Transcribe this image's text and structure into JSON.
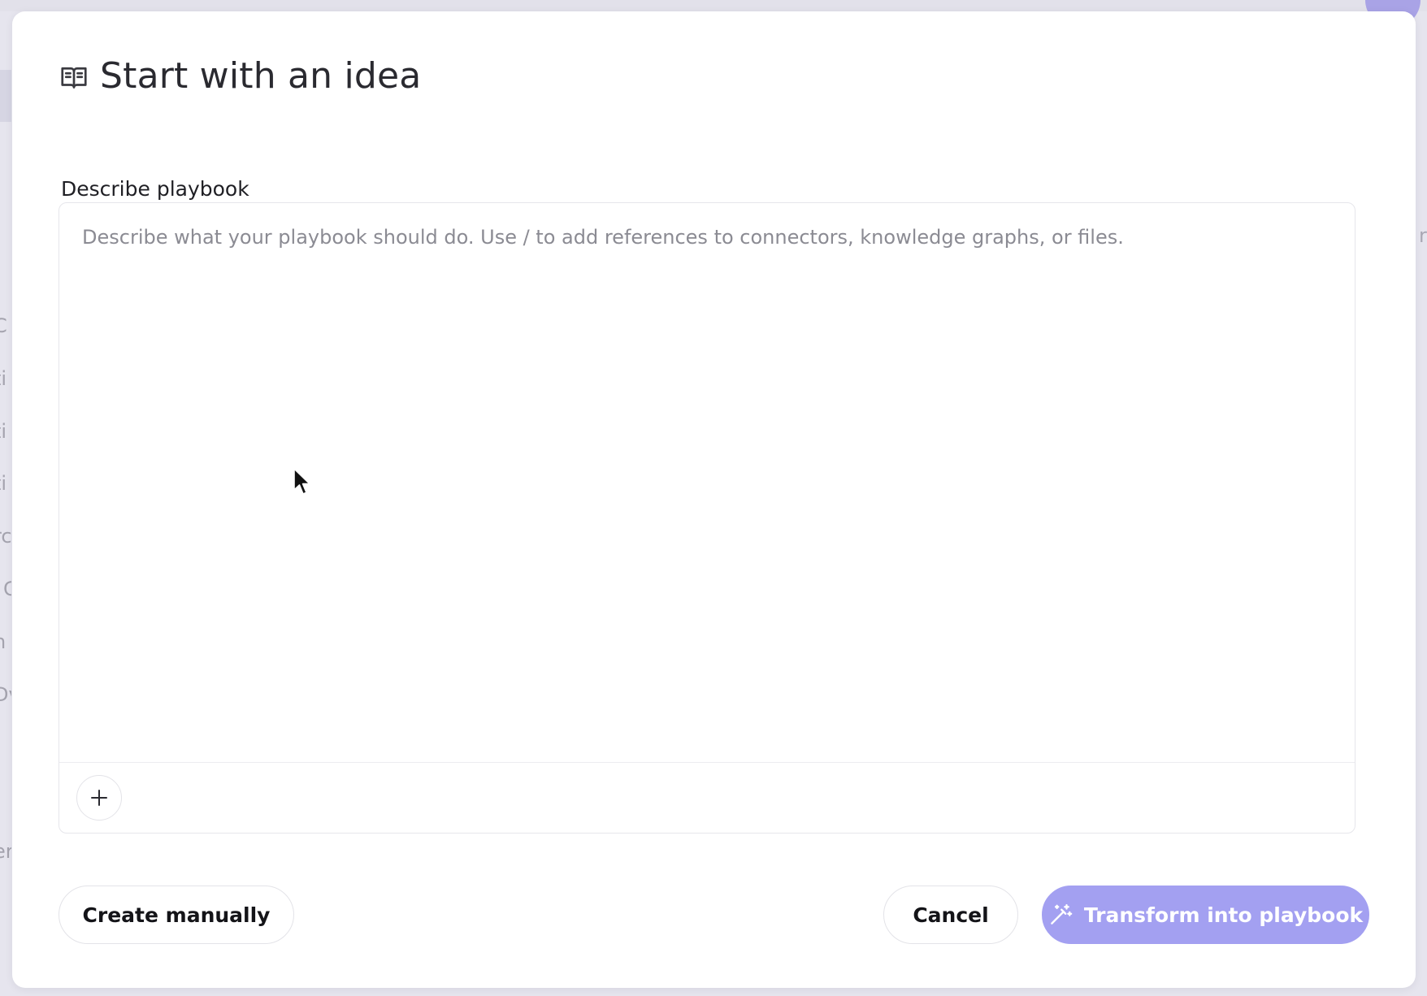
{
  "background": {
    "left_fragments": [
      "C",
      "ti",
      "ti",
      "ti",
      "rc",
      "C",
      "n",
      "Dv",
      "er"
    ],
    "right_fragment": "re"
  },
  "modal": {
    "title": "Start with an idea",
    "title_icon": "book-open-icon",
    "field_label": "Describe playbook",
    "editor": {
      "value": "",
      "placeholder": "Describe what your playbook should do. Use / to add references to connectors, knowledge graphs, or files.",
      "add_icon": "plus-icon"
    },
    "buttons": {
      "create_manually": "Create manually",
      "cancel": "Cancel",
      "transform": "Transform into playbook",
      "transform_icon": "magic-wand-icon"
    }
  },
  "colors": {
    "accent": "#a3a0f1",
    "overlay": "#e6e5ee"
  }
}
